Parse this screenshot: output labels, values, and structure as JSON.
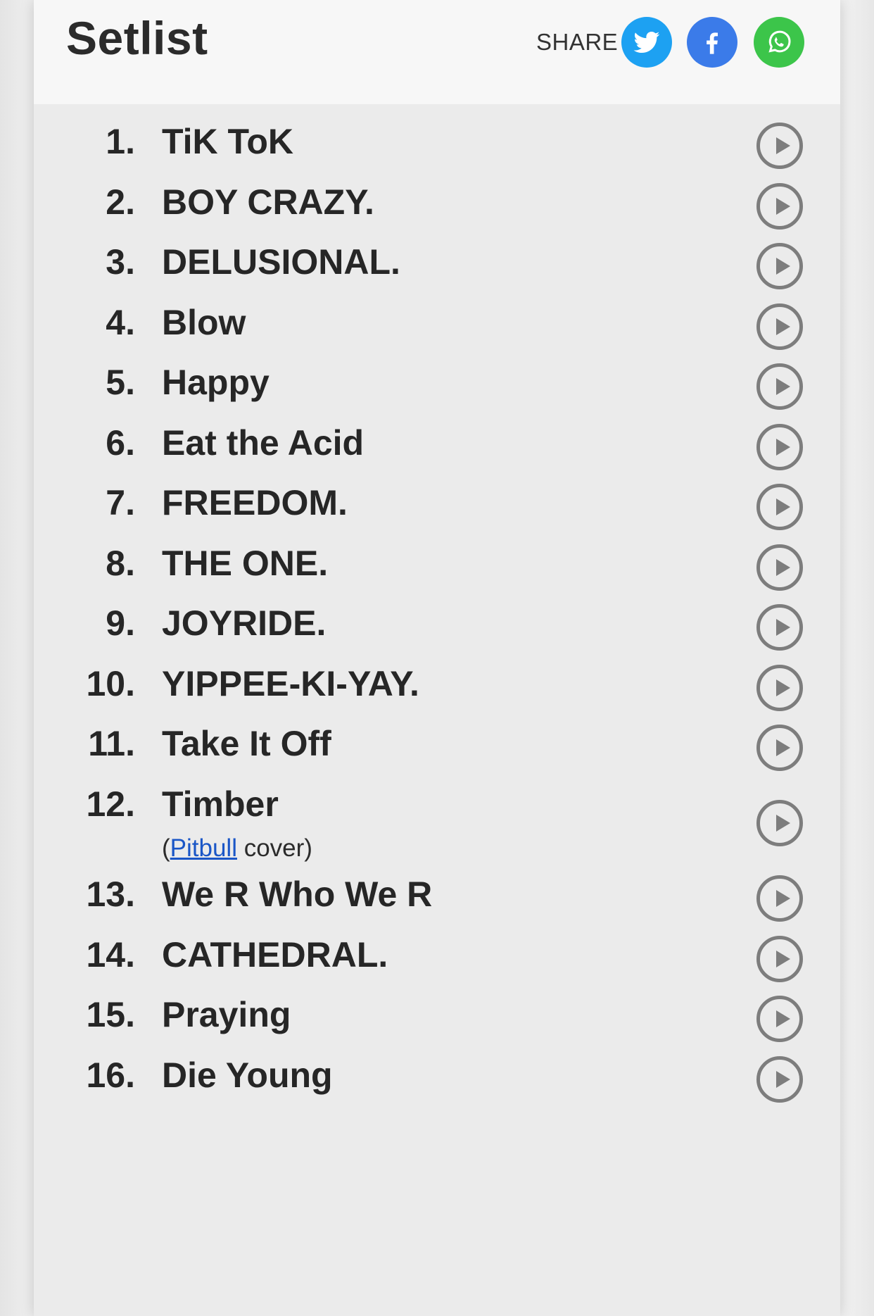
{
  "header": {
    "title": "Setlist",
    "share_label": "SHARE",
    "share_buttons": [
      {
        "name": "twitter",
        "icon": "twitter-icon",
        "color": "#1da1f2"
      },
      {
        "name": "facebook",
        "icon": "facebook-icon",
        "color": "#3b7be9"
      },
      {
        "name": "whatsapp",
        "icon": "whatsapp-icon",
        "color": "#3cc54a"
      }
    ]
  },
  "setlist": [
    {
      "num": "1.",
      "title": "TiK ToK"
    },
    {
      "num": "2.",
      "title": "BOY CRAZY."
    },
    {
      "num": "3.",
      "title": "DELUSIONAL."
    },
    {
      "num": "4.",
      "title": "Blow"
    },
    {
      "num": "5.",
      "title": "Happy"
    },
    {
      "num": "6.",
      "title": "Eat the Acid"
    },
    {
      "num": "7.",
      "title": "FREEDOM."
    },
    {
      "num": "8.",
      "title": "THE ONE."
    },
    {
      "num": "9.",
      "title": "JOYRIDE."
    },
    {
      "num": "10.",
      "title": "YIPPEE-KI-YAY."
    },
    {
      "num": "11.",
      "title": "Take It Off"
    },
    {
      "num": "12.",
      "title": "Timber",
      "cover_open": "(",
      "cover_artist": "Pitbull",
      "cover_close": " cover)"
    },
    {
      "num": "13.",
      "title": "We R Who We R"
    },
    {
      "num": "14.",
      "title": "CATHEDRAL."
    },
    {
      "num": "15.",
      "title": "Praying"
    },
    {
      "num": "16.",
      "title": "Die Young"
    }
  ],
  "colors": {
    "play_icon": "#7d7d7d",
    "link": "#1a56c7"
  }
}
